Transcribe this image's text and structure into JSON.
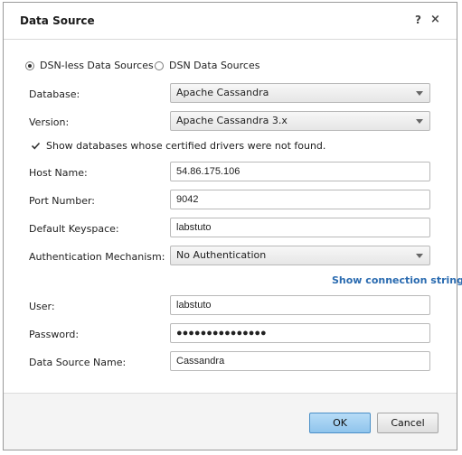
{
  "dialog": {
    "title": "Data Source",
    "help_icon": "?",
    "close_icon": "×"
  },
  "source_type": {
    "options": [
      {
        "label": "DSN-less Data Sources",
        "selected": true
      },
      {
        "label": "DSN Data Sources",
        "selected": false
      }
    ]
  },
  "fields": {
    "database": {
      "label": "Database:",
      "value": "Apache Cassandra"
    },
    "version": {
      "label": "Version:",
      "value": "Apache Cassandra 3.x"
    },
    "show_uncertified": {
      "label": "Show databases whose certified drivers were not found.",
      "checked": true
    },
    "host_name": {
      "label": "Host Name:",
      "value": "54.86.175.106"
    },
    "port_number": {
      "label": "Port Number:",
      "value": "9042"
    },
    "default_keyspace": {
      "label": "Default Keyspace:",
      "value": "labstuto"
    },
    "auth_mechanism": {
      "label": "Authentication Mechanism:",
      "value": "No Authentication"
    },
    "show_connection_string": "Show connection string",
    "user": {
      "label": "User:",
      "value": "labstuto"
    },
    "password": {
      "label": "Password:",
      "value": "●●●●●●●●●●●●●●●"
    },
    "data_source_name": {
      "label": "Data Source Name:",
      "value": "Cassandra"
    }
  },
  "buttons": {
    "ok": "OK",
    "cancel": "Cancel"
  },
  "colors": {
    "link": "#2a6bb0",
    "ok_button": "#a3d0f1"
  }
}
